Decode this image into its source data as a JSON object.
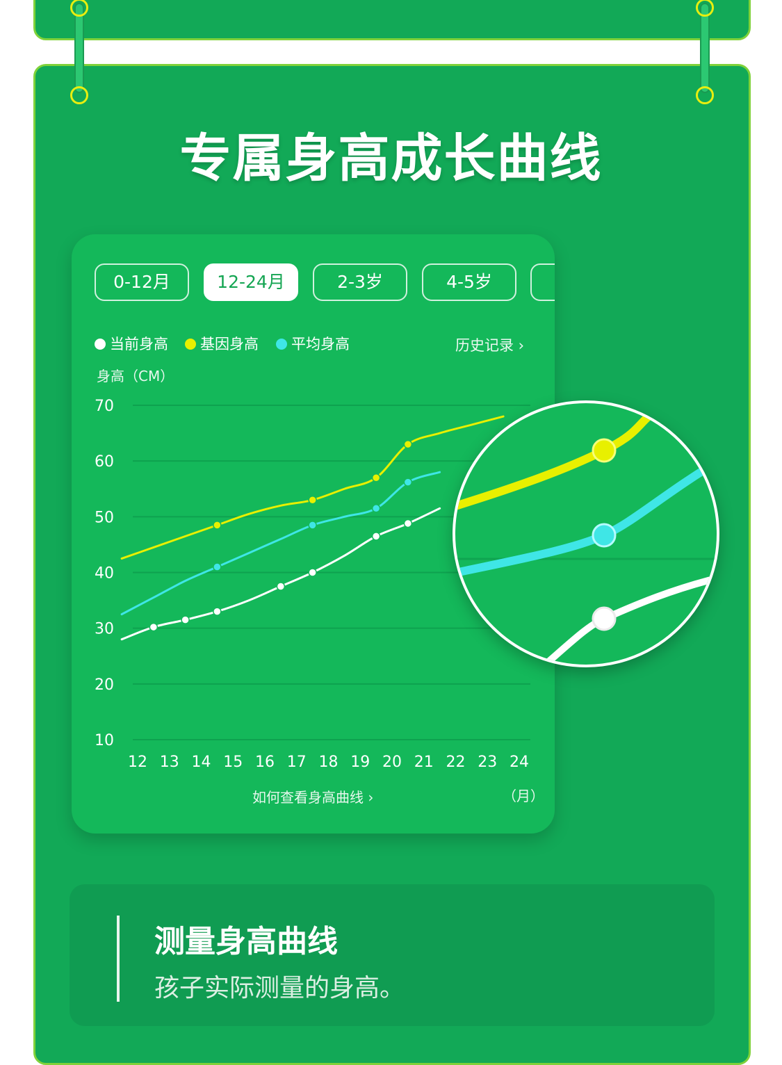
{
  "title": "专属身高成长曲线",
  "tabs": [
    {
      "label": "0-12月",
      "active": false
    },
    {
      "label": "12-24月",
      "active": true
    },
    {
      "label": "2-3岁",
      "active": false
    },
    {
      "label": "4-5岁",
      "active": false
    },
    {
      "label": "",
      "active": false
    }
  ],
  "history_link": "历史记录 ›",
  "how_to_link": "如何查看身高曲线 ›",
  "colors": {
    "current": "#ffffff",
    "gene": "#e8f000",
    "average": "#3fe6e6",
    "background": "#12a957"
  },
  "chart_data": {
    "type": "line",
    "ylabel": "身高（CM）",
    "xunit": "（月）",
    "x": [
      12,
      13,
      14,
      15,
      16,
      17,
      18,
      19,
      20,
      21,
      22,
      23,
      24
    ],
    "ylim": [
      10,
      70
    ],
    "yticks": [
      70,
      60,
      50,
      40,
      30,
      20,
      10
    ],
    "grid": true,
    "legend_position": "top-left",
    "series": [
      {
        "name": "当前身高",
        "color": "#ffffff",
        "points": [
          [
            11.5,
            28
          ],
          [
            12.5,
            30.2
          ],
          [
            13.5,
            31.5
          ],
          [
            14.5,
            33
          ],
          [
            15.5,
            35
          ],
          [
            16.5,
            37.5
          ],
          [
            17.5,
            40
          ],
          [
            18.5,
            43
          ],
          [
            19.5,
            46.5
          ],
          [
            20.5,
            48.8
          ],
          [
            21.5,
            51.5
          ]
        ],
        "markers": [
          [
            12.5,
            30.2
          ],
          [
            13.5,
            31.5
          ],
          [
            14.5,
            33
          ],
          [
            16.5,
            37.5
          ],
          [
            17.5,
            40
          ],
          [
            19.5,
            46.5
          ],
          [
            20.5,
            48.8
          ]
        ]
      },
      {
        "name": "基因身高",
        "color": "#e8f000",
        "points": [
          [
            11.5,
            42.5
          ],
          [
            12.5,
            44.5
          ],
          [
            13.5,
            46.5
          ],
          [
            14.5,
            48.5
          ],
          [
            15.5,
            50.5
          ],
          [
            16.5,
            52
          ],
          [
            17.5,
            53
          ],
          [
            18.5,
            55
          ],
          [
            19.5,
            57
          ],
          [
            20.5,
            63
          ],
          [
            21.5,
            65
          ],
          [
            22.5,
            66.5
          ],
          [
            23.5,
            68
          ]
        ],
        "markers": [
          [
            14.5,
            48.5
          ],
          [
            17.5,
            53
          ],
          [
            19.5,
            57
          ],
          [
            20.5,
            63
          ]
        ]
      },
      {
        "name": "平均身高",
        "color": "#3fe6e6",
        "points": [
          [
            11.5,
            32.5
          ],
          [
            12.5,
            35.5
          ],
          [
            13.5,
            38.5
          ],
          [
            14.5,
            41
          ],
          [
            15.5,
            43.5
          ],
          [
            16.5,
            46
          ],
          [
            17.5,
            48.5
          ],
          [
            18.5,
            50
          ],
          [
            19.5,
            51.5
          ],
          [
            20.5,
            56.2
          ],
          [
            21.5,
            58
          ]
        ],
        "markers": [
          [
            14.5,
            41
          ],
          [
            17.5,
            48.5
          ],
          [
            19.5,
            51.5
          ],
          [
            20.5,
            56.2
          ]
        ]
      }
    ]
  },
  "feature": {
    "title": "测量身高曲线",
    "description": "孩子实际测量的身高。"
  }
}
